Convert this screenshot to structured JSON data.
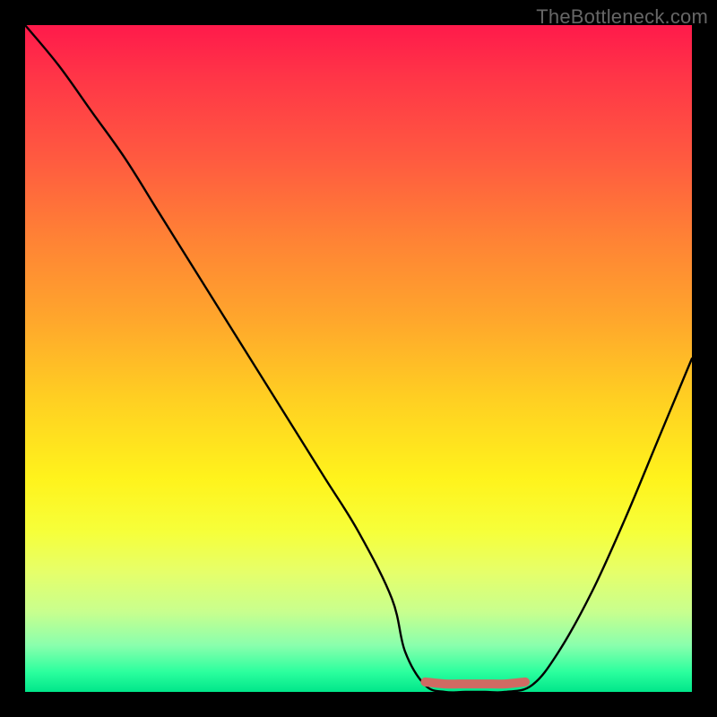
{
  "attribution": "TheBottleneck.com",
  "chart_data": {
    "type": "line",
    "title": "",
    "xlabel": "",
    "ylabel": "",
    "xlim": [
      0,
      100
    ],
    "ylim": [
      0,
      100
    ],
    "series": [
      {
        "name": "bottleneck-curve",
        "x": [
          0,
          5,
          10,
          15,
          20,
          25,
          30,
          35,
          40,
          45,
          50,
          55,
          57,
          60,
          63,
          66,
          69,
          72,
          76,
          80,
          85,
          90,
          95,
          100
        ],
        "y": [
          100,
          94,
          87,
          80,
          72,
          64,
          56,
          48,
          40,
          32,
          24,
          14,
          6,
          1,
          0,
          0,
          0,
          0,
          1,
          6,
          15,
          26,
          38,
          50
        ]
      },
      {
        "name": "optimal-range-marker",
        "x": [
          60,
          63,
          66,
          69,
          72,
          75
        ],
        "y": [
          1.5,
          1.2,
          1.2,
          1.2,
          1.2,
          1.5
        ]
      }
    ],
    "colors": {
      "curve": "#000000",
      "marker": "#d06a63"
    }
  }
}
